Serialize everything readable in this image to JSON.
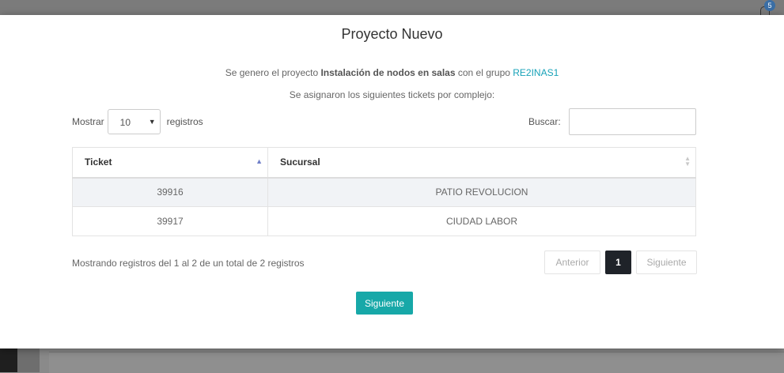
{
  "background": {
    "notification_count": "5"
  },
  "modal": {
    "title": "Proyecto Nuevo",
    "info_prefix": "Se genero el proyecto ",
    "project_name": "Instalación de nodos en salas",
    "info_mid": " con el grupo ",
    "group_name": "RE2INAS1",
    "tickets_note": "Se asignaron los siguientes tickets por complejo:"
  },
  "length_control": {
    "label_before": "Mostrar",
    "selected": "10",
    "label_after": "registros"
  },
  "search": {
    "label": "Buscar:",
    "value": ""
  },
  "table": {
    "columns": [
      "Ticket",
      "Sucursal"
    ],
    "rows": [
      [
        "39916",
        "PATIO REVOLUCION"
      ],
      [
        "39917",
        "CIUDAD LABOR"
      ]
    ]
  },
  "footer": {
    "info": "Mostrando registros del 1 al 2 de un total de 2 registros",
    "prev_label": "Anterior",
    "current_page": "1",
    "next_label": "Siguiente"
  },
  "actions": {
    "next_button": "Siguiente"
  },
  "colors": {
    "accent": "#17a8a8",
    "link": "#17a2b8",
    "active_page": "#1f2329"
  }
}
